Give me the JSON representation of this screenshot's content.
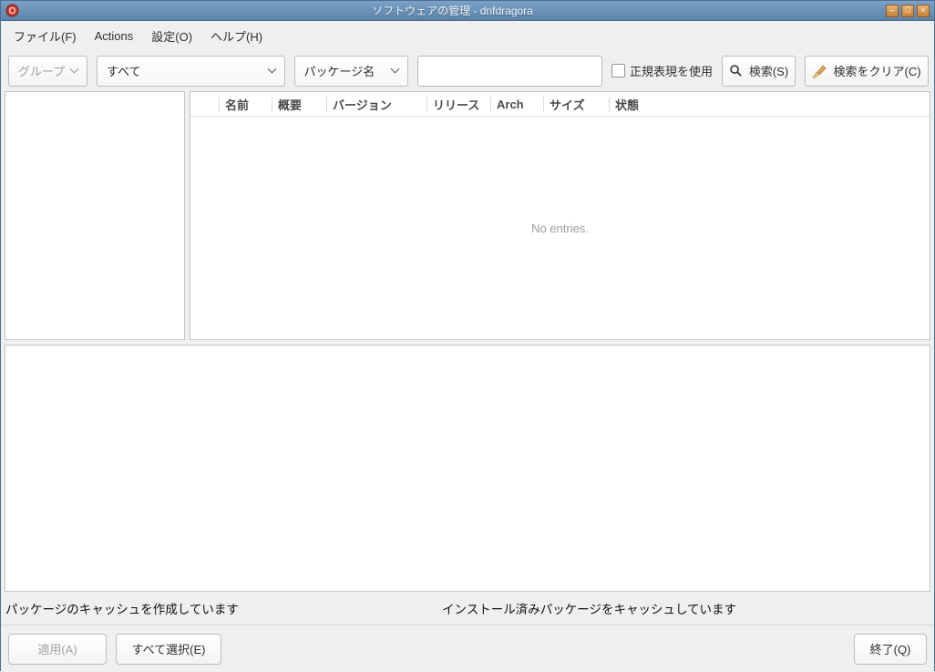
{
  "window": {
    "title": "ソフトウェアの管理 - dnfdragora",
    "controls": {
      "minimize": "–",
      "maximize": "□",
      "close": "×"
    }
  },
  "menubar": {
    "items": [
      {
        "label": "ファイル(F)"
      },
      {
        "label": "Actions"
      },
      {
        "label": "設定(O)"
      },
      {
        "label": "ヘルプ(H)"
      }
    ]
  },
  "toolbar": {
    "groups_button_label": "グループ",
    "filter_select_value": "すべて",
    "field_select_value": "パッケージ名",
    "search_input_value": "",
    "regex_checkbox_label": "正規表現を使用",
    "regex_checkbox_checked": false,
    "search_button_label": "検索(S)",
    "clear_button_label": "検索をクリア(C)"
  },
  "package_table": {
    "columns": [
      "名前",
      "概要",
      "バージョン",
      "リリース",
      "Arch",
      "サイズ",
      "状態"
    ],
    "rows": [],
    "empty_text": "No entries."
  },
  "statusbar": {
    "left_text": "パッケージのキャッシュを作成しています",
    "center_text": "インストール済みパッケージをキャッシュしています"
  },
  "footer": {
    "apply_label": "適用(A)",
    "apply_enabled": false,
    "select_all_label": "すべて選択(E)",
    "quit_label": "終了(Q)"
  },
  "colors": {
    "titlebar_blue": "#6b94bd",
    "window_background": "#efefef",
    "panel_background": "#ffffff",
    "control_button_orange": "#c77f35",
    "app_icon_red": "#c1382e",
    "disabled_text": "#a3a3a3",
    "empty_text_gray": "#9d9d9d"
  }
}
